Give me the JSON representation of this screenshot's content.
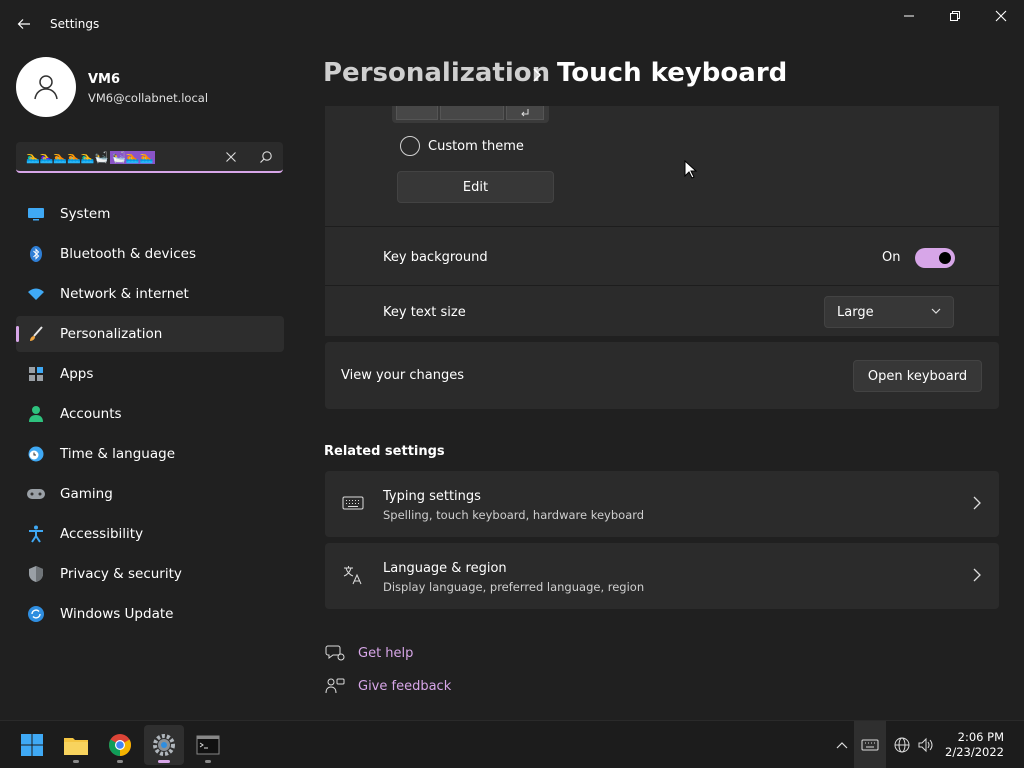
{
  "window": {
    "title": "Settings"
  },
  "user": {
    "name": "VM6",
    "email": "VM6@collabnet.local"
  },
  "search": {
    "emoji_text": "🏊‍♂️🏊‍♀️🏊🏊🏊‍♂️🛀",
    "emoji_selected": "🛀🏊🏊"
  },
  "sidebar": {
    "items": [
      {
        "label": "System",
        "icon": "monitor-icon"
      },
      {
        "label": "Bluetooth & devices",
        "icon": "bluetooth-icon"
      },
      {
        "label": "Network & internet",
        "icon": "wifi-icon"
      },
      {
        "label": "Personalization",
        "icon": "brush-icon"
      },
      {
        "label": "Apps",
        "icon": "apps-icon"
      },
      {
        "label": "Accounts",
        "icon": "person-icon"
      },
      {
        "label": "Time & language",
        "icon": "clock-globe-icon"
      },
      {
        "label": "Gaming",
        "icon": "gamepad-icon"
      },
      {
        "label": "Accessibility",
        "icon": "accessibility-icon"
      },
      {
        "label": "Privacy & security",
        "icon": "shield-icon"
      },
      {
        "label": "Windows Update",
        "icon": "update-icon"
      }
    ]
  },
  "header": {
    "parent": "Personalization",
    "current": "Touch keyboard"
  },
  "theme": {
    "custom_theme_label": "Custom theme",
    "edit_label": "Edit"
  },
  "key_background": {
    "label": "Key background",
    "state": "On",
    "on": true
  },
  "key_text_size": {
    "label": "Key text size",
    "value": "Large"
  },
  "view_changes": {
    "label": "View your changes",
    "button": "Open keyboard"
  },
  "related": {
    "heading": "Related settings",
    "items": [
      {
        "title": "Typing settings",
        "subtitle": "Spelling, touch keyboard, hardware keyboard",
        "icon": "keyboard-icon"
      },
      {
        "title": "Language & region",
        "subtitle": "Display language, preferred language, region",
        "icon": "language-icon"
      }
    ]
  },
  "help": {
    "get_help": "Get help",
    "give_feedback": "Give feedback"
  },
  "taskbar": {
    "time": "2:06 PM",
    "date": "2/23/2022"
  },
  "colors": {
    "accent": "#d7a6e8",
    "background": "#202020",
    "card": "#2b2b2b"
  }
}
